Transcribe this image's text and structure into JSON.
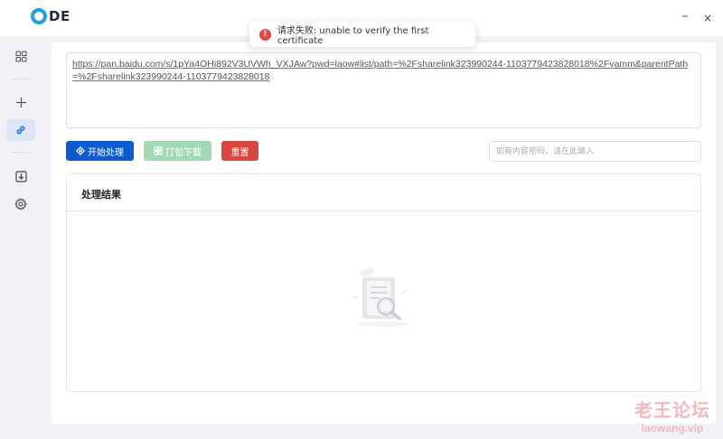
{
  "app": {
    "logo_text": "DE"
  },
  "window_controls": {
    "minimize": "–",
    "close": "×"
  },
  "toast": {
    "icon": "error-icon",
    "message": "请求失败: unable to verify the first certificate",
    "color": "#e04848"
  },
  "sidebar": {
    "items": [
      {
        "name": "grid-icon",
        "active": false
      },
      {
        "name": "plus-icon",
        "active": false
      },
      {
        "name": "link-icon",
        "active": true
      },
      {
        "name": "download-icon",
        "active": false
      },
      {
        "name": "gear-icon",
        "active": false
      }
    ]
  },
  "url_input": {
    "value": "https://pan.baidu.com/s/1pYa4OHi892V3UVWh_VXJAw?pwd=laow#list/path=%2Fsharelink323990244-1103779423828018%2Fvamm&parentPath=%2Fsharelink323990244-1103779423828018"
  },
  "actions": {
    "start_label": "开始处理",
    "pack_label": "打包下载",
    "reset_label": "重置"
  },
  "password": {
    "placeholder": "如有内容密码，请在此输入"
  },
  "result": {
    "title": "处理结果",
    "empty_icon": "empty-search-icon"
  },
  "watermark": {
    "title": "老王论坛",
    "url": "laowang.vip"
  },
  "colors": {
    "primary": "#0d5ccf",
    "success_disabled": "#a3d9b5",
    "danger": "#d9453f",
    "accent": "#1f9fe0"
  }
}
